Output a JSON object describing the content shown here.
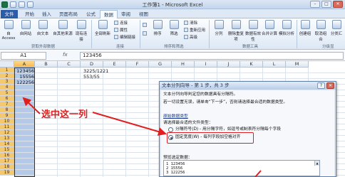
{
  "window": {
    "title": "工作簿1 - Microsoft Excel",
    "buttons": {
      "minimize": "–",
      "maximize": "□",
      "close": "✕"
    }
  },
  "ribbon_tabs": [
    "文件",
    "开始",
    "插入",
    "页面布局",
    "公式",
    "数据",
    "审阅",
    "视图"
  ],
  "active_tab": "数据",
  "ribbon": {
    "get_external": {
      "buttons": [
        "自 Access",
        "自网站",
        "自文本",
        "自其他来源",
        "现有连接"
      ],
      "label": "获取外部数据"
    },
    "connections": {
      "refresh": "全部刷新",
      "small": [
        "连接",
        "属性",
        "编辑链接"
      ],
      "label": "连接"
    },
    "sort_filter": {
      "sort": "排序",
      "filter": "筛选",
      "small": [
        "清除",
        "重新应用",
        "高级"
      ],
      "label": "排序和筛选"
    },
    "data_tools": {
      "buttons": [
        "分列",
        "删除重复项",
        "数据有效性",
        "合并计算",
        "模拟分析"
      ],
      "label": "数据工具"
    },
    "outline": {
      "buttons": [
        "创建组",
        "取消组合",
        "分类汇"
      ],
      "label": "分级显"
    }
  },
  "formula_bar": {
    "name_box": "A1",
    "fx": "fx",
    "value": "123456"
  },
  "columns": [
    "A",
    "B",
    "C",
    "D",
    "E",
    "F",
    "G",
    "H",
    "I",
    "J",
    "K",
    "L",
    "M"
  ],
  "rows": [
    "1",
    "2",
    "3",
    "4",
    "5",
    "6",
    "7",
    "8",
    "9",
    "10",
    "11",
    "12",
    "13",
    "14",
    "15",
    "16",
    "17",
    "18",
    "19"
  ],
  "cells": {
    "A1": "123456",
    "A2": "15556",
    "A3": "122256",
    "D1": "3225/1221",
    "D2": "553/55"
  },
  "annotation": "选中这一列",
  "dialog": {
    "title": "文本分列向导 - 第 1 步，共 3 步",
    "help": "?",
    "close": "✕",
    "line1": "文本分列向导判定您的数据具有分隔符。",
    "line2": "若一切设置无误，请单击“下一步”，否则请选择最合适的数据类型。",
    "section": "原始数据类型",
    "prompt": "请选择最合适的文件类型：",
    "option1": "分隔符号(D)  - 用分隔字符，如逗号或制表符分隔每个字段",
    "option2": "固定宽度(W)  - 每列字段加空格对齐",
    "preview_label": "预览选定数据：",
    "preview_lines": [
      "1 123456",
      "2 15556",
      "3 122256"
    ]
  },
  "colors": {
    "selection": "#b5c9e8",
    "highlight_header": "#f6b84f",
    "annotation_red": "#e02020",
    "file_tab": "#2a5caa"
  }
}
